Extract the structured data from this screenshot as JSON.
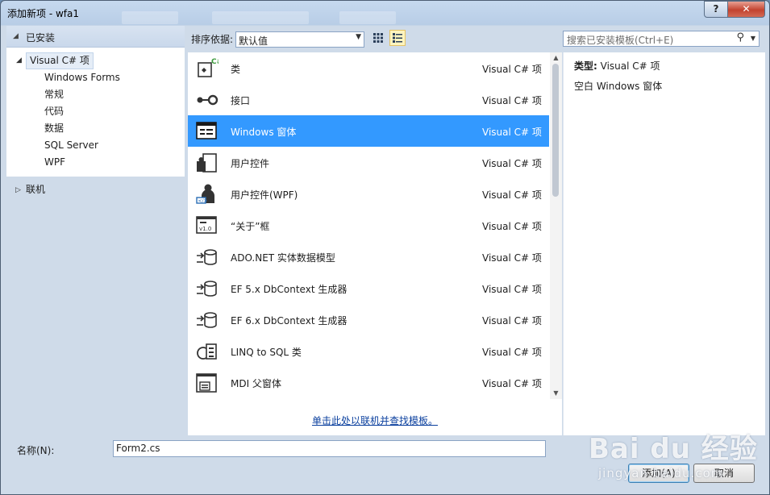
{
  "window": {
    "title": "添加新项 - wfa1",
    "help_label": "?",
    "close_label": "✕"
  },
  "left_panel": {
    "header": "已安装",
    "root": "Visual C# 项",
    "children": [
      "Windows Forms",
      "常规",
      "代码",
      "数据",
      "SQL Server",
      "WPF"
    ],
    "online": "联机"
  },
  "toolbar": {
    "sort_label": "排序依据:",
    "sort_value": "默认值",
    "search_placeholder": "搜索已安装模板(Ctrl+E)"
  },
  "templates": [
    {
      "name": "类",
      "type": "Visual C# 项",
      "icon": "class-icon"
    },
    {
      "name": "接口",
      "type": "Visual C# 项",
      "icon": "interface-icon"
    },
    {
      "name": "Windows 窗体",
      "type": "Visual C# 项",
      "icon": "windows-form-icon",
      "selected": true
    },
    {
      "name": "用户控件",
      "type": "Visual C# 项",
      "icon": "user-control-icon"
    },
    {
      "name": "用户控件(WPF)",
      "type": "Visual C# 项",
      "icon": "user-control-wpf-icon"
    },
    {
      "name": "“关于”框",
      "type": "Visual C# 项",
      "icon": "about-box-icon"
    },
    {
      "name": "ADO.NET 实体数据模型",
      "type": "Visual C# 项",
      "icon": "entity-model-icon"
    },
    {
      "name": "EF 5.x DbContext 生成器",
      "type": "Visual C# 项",
      "icon": "dbcontext-icon"
    },
    {
      "name": "EF 6.x DbContext 生成器",
      "type": "Visual C# 项",
      "icon": "dbcontext-icon"
    },
    {
      "name": "LINQ to SQL 类",
      "type": "Visual C# 项",
      "icon": "linq-icon"
    },
    {
      "name": "MDI 父窗体",
      "type": "Visual C# 项",
      "icon": "mdi-form-icon"
    }
  ],
  "online_link": "单击此处以联机并查找模板。",
  "details": {
    "type_label": "类型:",
    "type_value": "Visual C# 项",
    "description": "空白 Windows 窗体"
  },
  "name_field": {
    "label": "名称(N):",
    "value": "Form2.cs"
  },
  "buttons": {
    "add": "添加(A)",
    "cancel": "取消"
  },
  "watermark": {
    "brand": "Bai du 经验",
    "url": "jingyan.baidu.com"
  }
}
